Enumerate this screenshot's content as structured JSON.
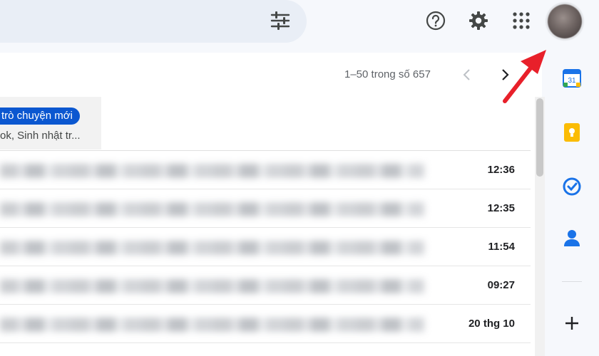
{
  "toolbar": {
    "search_options": "tune-icon",
    "help": "help-icon",
    "settings": "gear-icon",
    "apps": "apps-icon",
    "account": "avatar"
  },
  "pager": {
    "range_text": "1–50 trong số 657",
    "prev": "chevron-left-icon",
    "next": "chevron-right-icon"
  },
  "promo": {
    "chip_label": "trò chuyện mới",
    "subtitle": "ok, Sinh nhật tr..."
  },
  "emails": [
    {
      "time": "12:36"
    },
    {
      "time": "12:35"
    },
    {
      "time": "11:54"
    },
    {
      "time": "09:27"
    },
    {
      "time": "20 thg 10"
    }
  ],
  "side_panel": {
    "calendar_day": "31",
    "apps": [
      "calendar-icon",
      "keep-icon",
      "tasks-icon",
      "contacts-icon",
      "add-icon"
    ]
  },
  "colors": {
    "accent": "#0b57d0",
    "arrow": "#e8202a",
    "keep": "#fbbc04",
    "tasks": "#1a73e8",
    "contacts": "#1a73e8"
  }
}
